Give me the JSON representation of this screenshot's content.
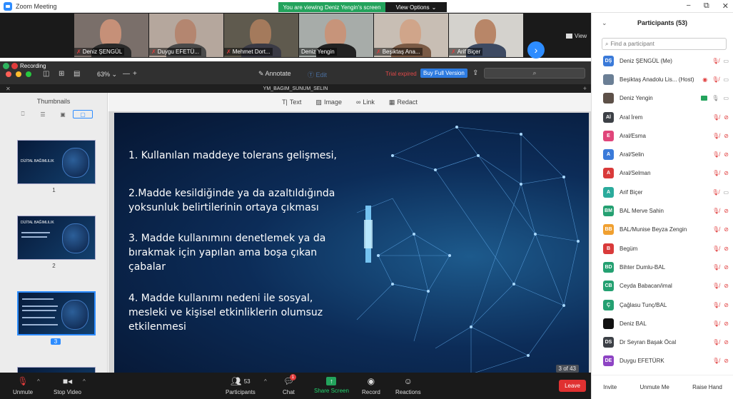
{
  "window": {
    "title": "Zoom Meeting",
    "controls": [
      "−",
      "⧉",
      "✕"
    ]
  },
  "banner": {
    "viewing": "You are viewing Deniz Yengin's screen",
    "view_options": "View Options"
  },
  "video_strip": {
    "tiles": [
      {
        "name": "Deniz ŞENGÜL",
        "muted": true,
        "skin": "#c69078",
        "bg": "#7a6f6a",
        "shirt": "#2a2a2a"
      },
      {
        "name": "Duygu EFETÜ...",
        "muted": true,
        "skin": "#b48670",
        "bg": "#b5a79d",
        "shirt": "#4a4a4a"
      },
      {
        "name": "Mehmet Dort...",
        "muted": true,
        "skin": "#a47a5c",
        "bg": "#5f5a4e",
        "shirt": "#3a3a45"
      },
      {
        "name": "Deniz Yengin",
        "muted": false,
        "skin": "#c7947a",
        "bg": "#a7aca9",
        "shirt": "#222"
      },
      {
        "name": "Beşiktaş Ana...",
        "muted": true,
        "skin": "#d0a58a",
        "bg": "#c8beb4",
        "shirt": "#7a5a45"
      },
      {
        "name": "Arif Biçer",
        "muted": true,
        "skin": "#b88668",
        "bg": "#d4d2cd",
        "shirt": "#3d4a62"
      }
    ],
    "view_label": "View"
  },
  "recording": {
    "label": "Recording"
  },
  "pdf_toolbar": {
    "zoom": "63%",
    "annotate": "Annotate",
    "edit": "Edit",
    "trial": "Trial expired",
    "buy": "Buy Full Version",
    "search_icon": "⌕"
  },
  "document": {
    "filename": "YM_BAGIM_SUNUM_SELIN"
  },
  "thumbnails": {
    "title": "Thumbnails",
    "pages": [
      {
        "num": "1",
        "label": "DİJİTAL BAĞIMLILIK"
      },
      {
        "num": "2",
        "label": "DİJİTAL BAĞIMLILIK"
      },
      {
        "num": "3",
        "label": ""
      }
    ]
  },
  "doc_tools": {
    "text": "Text",
    "image": "Image",
    "link": "Link",
    "redact": "Redact"
  },
  "slide": {
    "points": [
      "1. Kullanılan maddeye tolerans gelişmesi,",
      "2.Madde kesildiğinde ya da azaltıldığında",
      "yoksunluk belirtilerinin ortaya çıkması",
      "3. Madde kullanımını denetlemek ya da",
      "bırakmak için yapılan ama boşa çıkan",
      "çabalar",
      "4. Madde kullanımı nedeni ile sosyal,",
      "mesleki ve kişisel etkinliklerin olumsuz",
      "etkilenmesi"
    ],
    "page_counter": "3 of 43"
  },
  "controls": {
    "unmute": "Unmute",
    "stop_video": "Stop Video",
    "participants": "Participants",
    "participants_count": "53",
    "chat": "Chat",
    "chat_badge": "1",
    "share": "Share Screen",
    "record": "Record",
    "reactions": "Reactions",
    "leave": "Leave"
  },
  "participants_panel": {
    "title": "Participants (53)",
    "search_placeholder": "Find a participant",
    "list": [
      {
        "initials": "DŞ",
        "color": "#3a7ad9",
        "name": "Deniz ŞENGÜL (Me)",
        "mic": "off",
        "cam": "on"
      },
      {
        "initials": "",
        "color": "#6b7f95",
        "name": "Beşiktaş Anadolu Lis... (Host)",
        "mic": "off",
        "cam": "on",
        "rec": true,
        "photo": true
      },
      {
        "initials": "",
        "color": "#5d5048",
        "name": "Deniz Yengin",
        "mic": "on",
        "cam": "on",
        "sharing": true,
        "photo": true
      },
      {
        "initials": "Aİ",
        "color": "#3c4046",
        "name": "Aral İrem",
        "mic": "off",
        "cam": "off"
      },
      {
        "initials": "E",
        "color": "#e0457a",
        "name": "Aral/Esma",
        "mic": "off",
        "cam": "off"
      },
      {
        "initials": "A",
        "color": "#3a7ad9",
        "name": "Aral/Selin",
        "mic": "off",
        "cam": "off"
      },
      {
        "initials": "A",
        "color": "#d93a3a",
        "name": "Aral/Selman",
        "mic": "off",
        "cam": "off"
      },
      {
        "initials": "A",
        "color": "#2bab9c",
        "name": "Arif Biçer",
        "mic": "off",
        "cam": "on"
      },
      {
        "initials": "BM",
        "color": "#24a071",
        "name": "BAL Merve Sahin",
        "mic": "off",
        "cam": "off"
      },
      {
        "initials": "BB",
        "color": "#f0a030",
        "name": "BAL/Munise Beyza Zengin",
        "mic": "off",
        "cam": "off"
      },
      {
        "initials": "B",
        "color": "#d93a3a",
        "name": "Begüm",
        "mic": "off",
        "cam": "off"
      },
      {
        "initials": "BD",
        "color": "#24a071",
        "name": "Bihter Dumlu-BAL",
        "mic": "off",
        "cam": "off"
      },
      {
        "initials": "CB",
        "color": "#24a071",
        "name": "Ceyda Babacan/imal",
        "mic": "off",
        "cam": "off"
      },
      {
        "initials": "Ç",
        "color": "#24a071",
        "name": "Çağlasu Tunç/BAL",
        "mic": "off",
        "cam": "off"
      },
      {
        "initials": "",
        "color": "#111111",
        "name": "Deniz BAL",
        "mic": "off",
        "cam": "off"
      },
      {
        "initials": "DS",
        "color": "#3c4046",
        "name": "Dr Seyran Başak Öcal",
        "mic": "off",
        "cam": "off"
      },
      {
        "initials": "DE",
        "color": "#8e44c4",
        "name": "Duygu EFETÜRK",
        "mic": "off",
        "cam": "off"
      }
    ],
    "footer": {
      "invite": "Invite",
      "unmute_me": "Unmute Me",
      "raise_hand": "Raise Hand"
    }
  }
}
